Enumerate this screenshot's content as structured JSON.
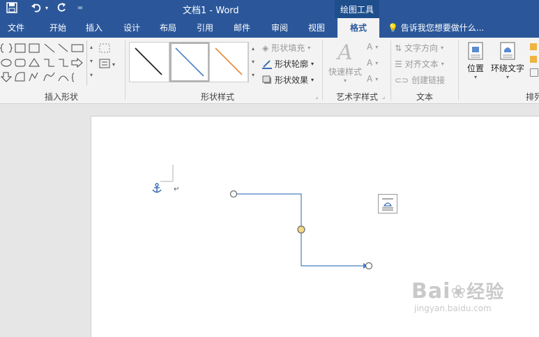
{
  "window": {
    "title": "文档1 - Word",
    "context_tab": "绘图工具"
  },
  "qat": {
    "save_icon": "save-icon",
    "undo_icon": "undo-icon",
    "redo_icon": "redo-icon",
    "customize_icon": "customize-qat-icon"
  },
  "tabs": [
    {
      "label": "文件"
    },
    {
      "label": "开始"
    },
    {
      "label": "插入"
    },
    {
      "label": "设计"
    },
    {
      "label": "布局"
    },
    {
      "label": "引用"
    },
    {
      "label": "邮件"
    },
    {
      "label": "审阅"
    },
    {
      "label": "视图"
    },
    {
      "label": "格式",
      "active": true
    }
  ],
  "tell_me": {
    "text": "告诉我您想要做什么..."
  },
  "ribbon": {
    "insert_shapes": {
      "label": "插入形状"
    },
    "shape_styles": {
      "label": "形状样式",
      "fill": "形状填充",
      "outline": "形状轮廓",
      "effect": "形状效果",
      "style_colors": [
        "#222222",
        "#4a7fc1",
        "#e8883a"
      ]
    },
    "wordart": {
      "label": "艺术字样式",
      "quick_styles": "快速样式"
    },
    "text": {
      "label": "文本",
      "direction": "文字方向",
      "align": "对齐文本",
      "link": "创建链接"
    },
    "arrange": {
      "label": "排列",
      "position": "位置",
      "wrap": "环绕文字"
    }
  },
  "document": {
    "anchor_icon": "anchor-icon",
    "paragraph_mark": "↵",
    "layout_options_icon": "layout-options-icon",
    "connector_color": "#4a7fc1",
    "handle_color": "#f3d884"
  },
  "watermark": {
    "brand": "Bai",
    "brand2": "经验",
    "url": "jingyan.baidu.com"
  }
}
